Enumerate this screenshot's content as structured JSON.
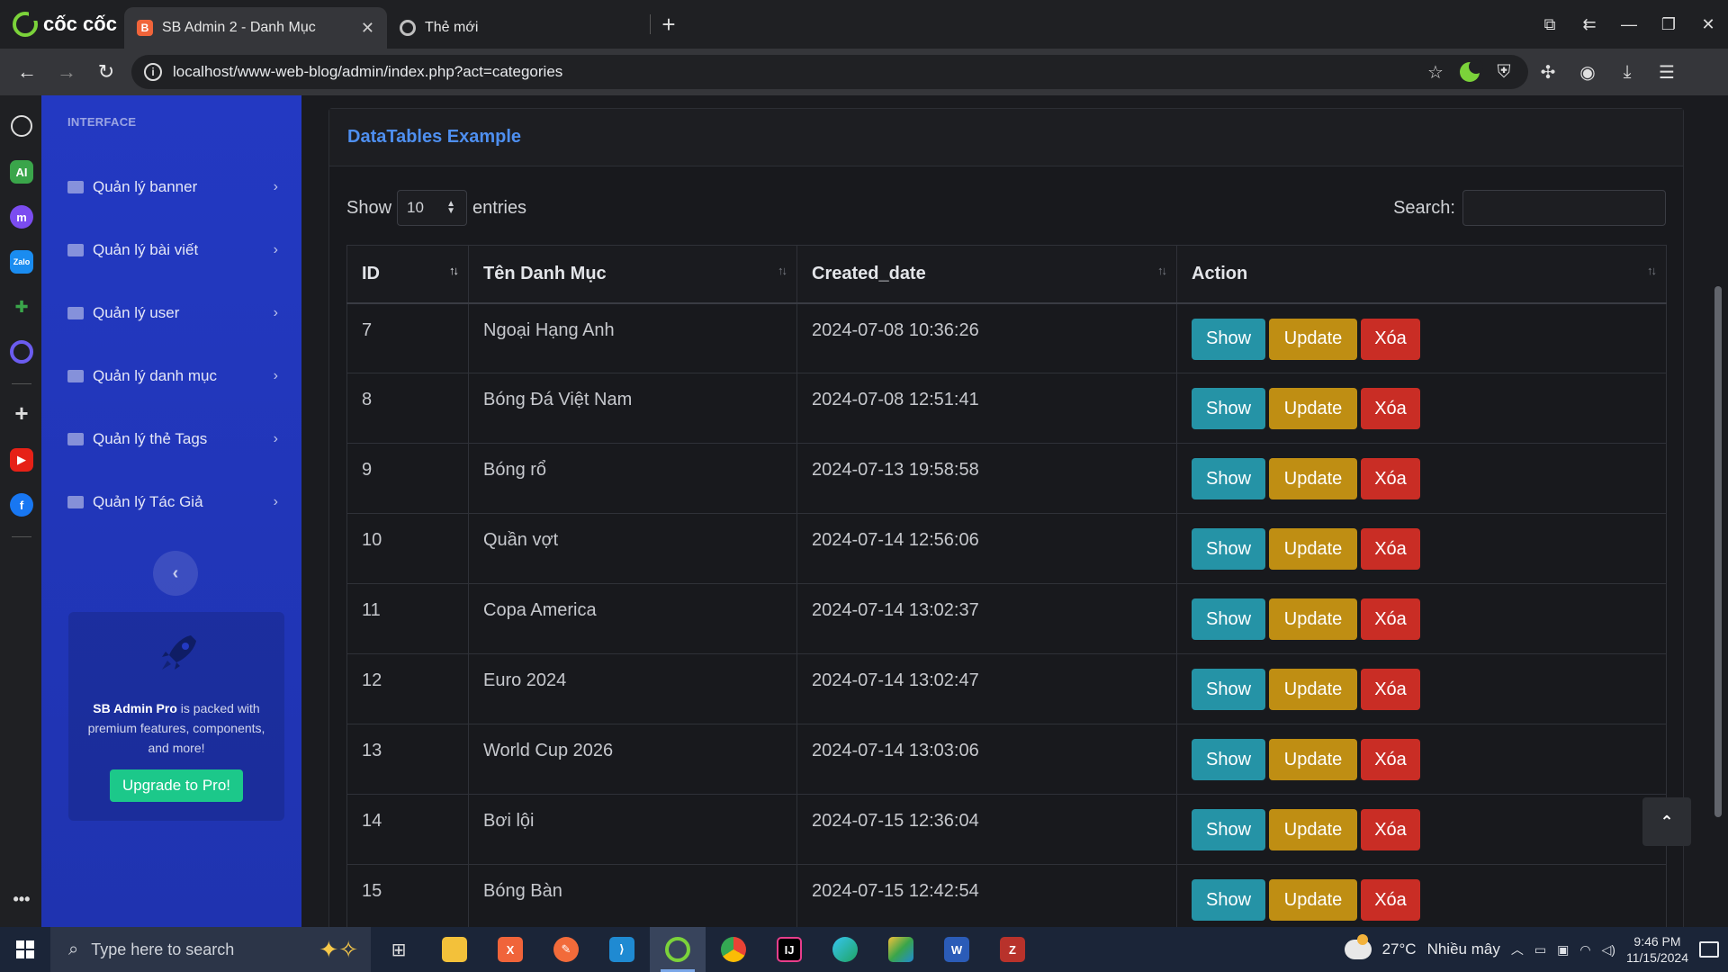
{
  "browser": {
    "brand": "cốc cốc",
    "tabs": [
      {
        "title": "SB Admin 2 - Danh Mục",
        "active": true
      },
      {
        "title": "Thẻ mới",
        "active": false
      }
    ],
    "url": "localhost/www-web-blog/admin/index.php?act=categories"
  },
  "sidebar": {
    "heading": "INTERFACE",
    "items": [
      {
        "label": "Quản lý banner",
        "icon": "image-icon"
      },
      {
        "label": "Quản lý bài viết",
        "icon": "newspaper-icon"
      },
      {
        "label": "Quản lý user",
        "icon": "folder-icon"
      },
      {
        "label": "Quản lý danh mục",
        "icon": "folder-icon"
      },
      {
        "label": "Quản lý thẻ Tags",
        "icon": "tags-icon"
      },
      {
        "label": "Quản lý Tác Giả",
        "icon": "users-icon"
      }
    ],
    "promo": {
      "brand": "SB Admin Pro",
      "text": " is packed with premium features, components, and more!",
      "button": "Upgrade to Pro!"
    }
  },
  "card": {
    "title": "DataTables Example",
    "show_label": "Show",
    "entries_label": "entries",
    "page_length": "10",
    "search_label": "Search:"
  },
  "table": {
    "columns": [
      "ID",
      "Tên Danh Mục",
      "Created_date",
      "Action"
    ],
    "buttons": {
      "show": "Show",
      "update": "Update",
      "delete": "Xóa"
    },
    "rows": [
      {
        "id": "7",
        "name": "Ngoại Hạng Anh",
        "created": "2024-07-08 10:36:26"
      },
      {
        "id": "8",
        "name": "Bóng Đá Việt Nam",
        "created": "2024-07-08 12:51:41"
      },
      {
        "id": "9",
        "name": "Bóng rổ",
        "created": "2024-07-13 19:58:58"
      },
      {
        "id": "10",
        "name": "Quần vợt",
        "created": "2024-07-14 12:56:06"
      },
      {
        "id": "11",
        "name": "Copa America",
        "created": "2024-07-14 13:02:37"
      },
      {
        "id": "12",
        "name": "Euro 2024",
        "created": "2024-07-14 13:02:47"
      },
      {
        "id": "13",
        "name": "World Cup 2026",
        "created": "2024-07-14 13:03:06"
      },
      {
        "id": "14",
        "name": "Bơi lội",
        "created": "2024-07-15 12:36:04"
      },
      {
        "id": "15",
        "name": "Bóng Bàn",
        "created": "2024-07-15 12:42:54"
      }
    ]
  },
  "taskbar": {
    "search_placeholder": "Type here to search",
    "weather_temp": "27°C",
    "weather_text": "Nhiều mây",
    "time": "9:46 PM",
    "date": "11/15/2024"
  },
  "colors": {
    "sidebar": "#2339c2",
    "show": "#2593a6",
    "update": "#bf8e13",
    "delete": "#c92d25",
    "promo_button": "#1cc88a",
    "card_title": "#4e8ff0"
  }
}
